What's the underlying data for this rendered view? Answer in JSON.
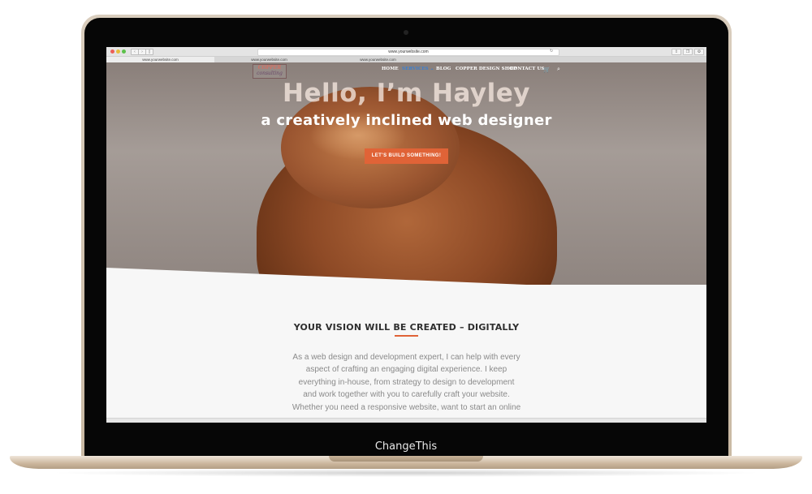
{
  "browser": {
    "url": "www.yourwebsite.com",
    "tabs": [
      "www.yourwebsite.com",
      "www.yourwebsite.com",
      "www.yourwebsite.com"
    ]
  },
  "site": {
    "logo_top": "COPPER",
    "logo_bottom": "consulting",
    "nav": [
      "HOME",
      "SERVICES",
      "BLOG",
      "COPPER DESIGN SHOP",
      "CONTACT US"
    ],
    "active_nav": "SERVICES"
  },
  "hero": {
    "title": "Hello, I’m Hayley",
    "subtitle": "a creatively inclined web designer",
    "cta_label": "LET'S BUILD SOMETHING!"
  },
  "section": {
    "title": "YOUR VISION WILL BE CREATED – DIGITALLY",
    "lines": [
      "As a web design and development expert, I can help with every",
      "aspect of crafting an engaging digital experience. I keep",
      "everything in-house, from strategy to design to development",
      "and work together with you to carefully craft your website.",
      "Whether you need a responsive website, want to start an online"
    ]
  },
  "laptop": {
    "brand_text": "ChangeThis"
  },
  "colors": {
    "accent": "#e06337",
    "active_nav": "#3b7fd1"
  }
}
